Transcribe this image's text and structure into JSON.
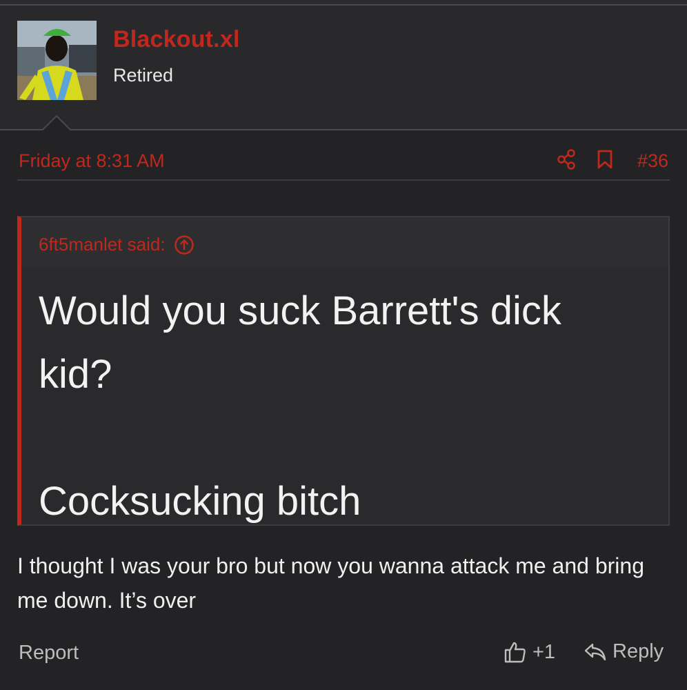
{
  "user": {
    "name": "Blackout.xl",
    "title": "Retired",
    "avatar_icon": "user-avatar-photo"
  },
  "post": {
    "date": "Friday at 8:31 AM",
    "number": "#36",
    "share_icon": "share-icon",
    "bookmark_icon": "bookmark-icon"
  },
  "quote": {
    "attribution": "6ft5manlet said:",
    "lines": [
      "Would you suck Barrett's dick",
      "kid?",
      "Cocksucking bitch"
    ]
  },
  "body": {
    "text": "I thought I was your bro but now you wanna attack me and bring me down. It’s over"
  },
  "actions": {
    "report": "Report",
    "like_count": "+1",
    "reply": "Reply"
  },
  "colors": {
    "accent": "#c0281e",
    "background": "#232325",
    "text": "#e6e6e6"
  }
}
